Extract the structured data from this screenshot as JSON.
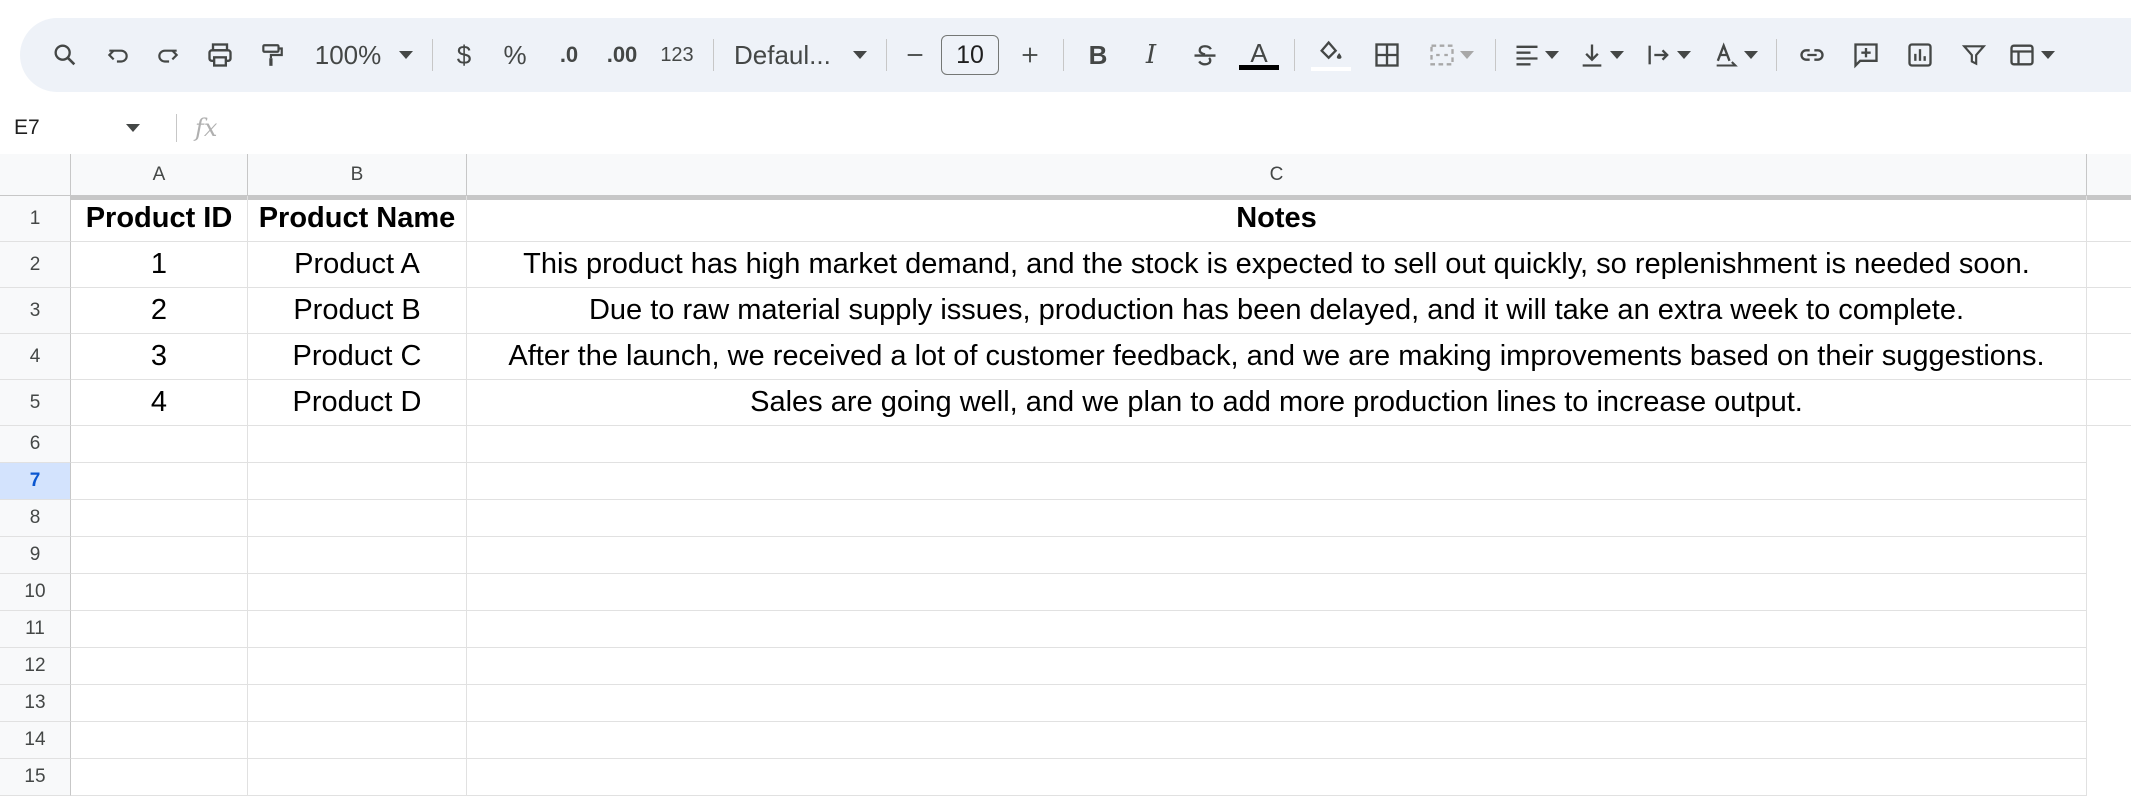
{
  "toolbar": {
    "zoom": "100%",
    "currency": "$",
    "percent": "%",
    "decrease_decimal": ".0",
    "increase_decimal": ".00",
    "number_format": "123",
    "font": "Defaul...",
    "font_size": "10",
    "text_color": "#000000"
  },
  "formula_bar": {
    "cell_ref": "E7",
    "fx": "fx"
  },
  "sheet": {
    "columns": [
      "A",
      "B",
      "C"
    ],
    "rows": [
      "1",
      "2",
      "3",
      "4",
      "5",
      "6",
      "7",
      "8",
      "9",
      "10",
      "11",
      "12",
      "13",
      "14",
      "15"
    ],
    "header": [
      "Product ID",
      "Product Name",
      "Notes"
    ],
    "data": [
      [
        "1",
        "Product A",
        "This product has high market demand, and the stock is expected to sell out quickly, so replenishment is needed soon."
      ],
      [
        "2",
        "Product B",
        "Due to raw material supply issues, production has been delayed, and it will take an extra week to complete."
      ],
      [
        "3",
        "Product C",
        "After the launch, we received a lot of customer feedback, and we are making improvements based on their suggestions."
      ],
      [
        "4",
        "Product D",
        "Sales are going well, and we plan to add more production lines to increase output."
      ]
    ],
    "active_row": "7"
  }
}
